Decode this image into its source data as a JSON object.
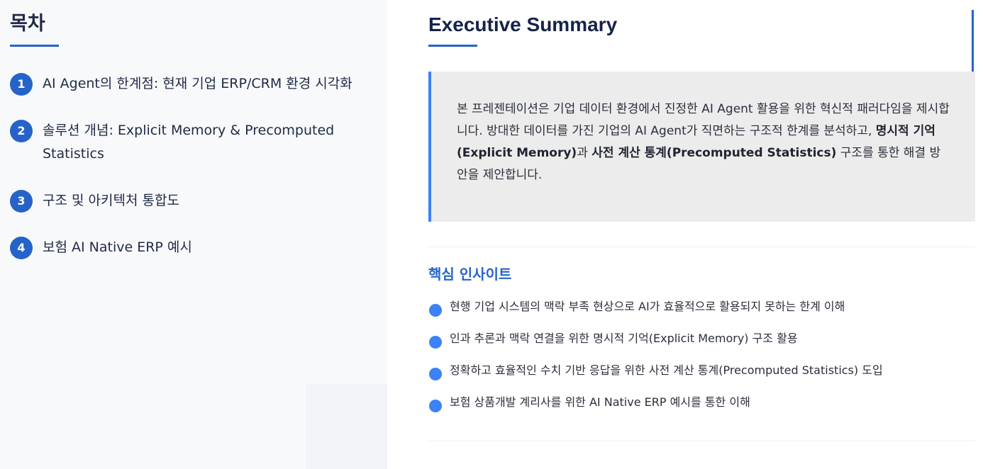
{
  "toc": {
    "title": "목차",
    "items": [
      {
        "number": "1",
        "label": "AI Agent의 한계점: 현재 기업 ERP/CRM 환경 시각화"
      },
      {
        "number": "2",
        "label": "솔루션 개념: Explicit Memory & Precomputed Statistics"
      },
      {
        "number": "3",
        "label": "구조 및 아키텍처 통합도"
      },
      {
        "number": "4",
        "label": "보험 AI Native ERP 예시"
      }
    ]
  },
  "main": {
    "title": "Executive Summary",
    "summary": {
      "part1": "본 프레젠테이션은 기업 데이터 환경에서 진정한 AI Agent 활용을 위한 혁신적 패러다임을 제시합니다. 방대한 데이터를 가진 기업의 AI Agent가 직면하는 구조적 한계를 분석하고, ",
      "bold1": "명시적 기억(Explicit Memory)",
      "part2": "과 ",
      "bold2": "사전 계산 통계(Precomputed Statistics)",
      "part3": " 구조를 통한 해결 방안을 제안합니다."
    },
    "insights": {
      "title": "핵심 인사이트",
      "items": [
        "현행 기업 시스템의 맥락 부족 현상으로 AI가 효율적으로 활용되지 못하는 한계 이해",
        "인과 추론과 맥락 연결을 위한 명시적 기억(Explicit Memory) 구조 활용",
        "정확하고 효율적인 수치 기반 응답을 위한 사전 계산 통계(Precomputed Statistics) 도입",
        "보험 상품개발 계리사를 위한 AI Native ERP 예시를 통한 이해"
      ]
    }
  },
  "colors": {
    "accent": "#2563c9",
    "bullet": "#3b82f6",
    "title_text": "#15234a",
    "summary_bg": "#ececec",
    "toc_bg": "#f8f9fb"
  }
}
